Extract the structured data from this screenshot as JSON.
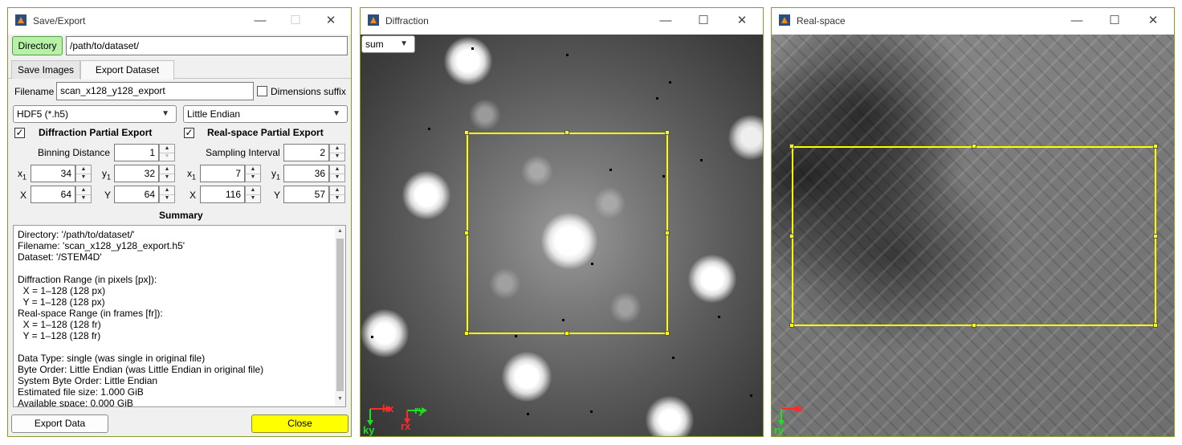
{
  "save_export": {
    "window_title": "Save/Export",
    "directory_button": "Directory",
    "directory_value": "/path/to/dataset/",
    "tabs": [
      "Save Images",
      "Export Dataset"
    ],
    "filename_label": "Filename",
    "filename_value": "scan_x128_y128_export",
    "dimensions_suffix_label": "Dimensions suffix",
    "format_value": "HDF5 (*.h5)",
    "endian_value": "Little Endian",
    "diffraction_partial_label": "Diffraction Partial Export",
    "realspace_partial_label": "Real-space Partial Export",
    "binning_label": "Binning Distance",
    "binning_value": "1",
    "sampling_label": "Sampling Interval",
    "sampling_value": "2",
    "diff_x1_label": "x",
    "diff_x1_sub": "1",
    "diff_x1": "34",
    "diff_y1_label": "y",
    "diff_y1_sub": "1",
    "diff_y1": "32",
    "diff_X_label": "X",
    "diff_X": "64",
    "diff_Y_label": "Y",
    "diff_Y": "64",
    "real_x1_label": "x",
    "real_x1_sub": "1",
    "real_x1": "7",
    "real_y1_label": "y",
    "real_y1_sub": "1",
    "real_y1": "36",
    "real_X_label": "X",
    "real_X": "116",
    "real_Y_label": "Y",
    "real_Y": "57",
    "summary_heading": "Summary",
    "summary_lines": [
      "Directory: '/path/to/dataset/'",
      "Filename: 'scan_x128_y128_export.h5'",
      "Dataset: '/STEM4D'",
      "",
      "Diffraction Range (in pixels [px]):",
      "  X = 1–128 (128 px)",
      "  Y = 1–128 (128 px)",
      "Real-space Range (in frames [fr]):",
      "  X = 1–128 (128 fr)",
      "  Y = 1–128 (128 fr)",
      "",
      "Data Type: single (was single in original file)",
      "Byte Order: Little Endian (was Little Endian in original file)",
      "System Byte Order: Little Endian",
      "Estimated file size: 1.000 GiB",
      "Available space: 0.000 GiB"
    ],
    "export_button": "Export Data",
    "close_button": "Close",
    "close_color": "#ffff00"
  },
  "diffraction": {
    "window_title": "Diffraction",
    "mode_value": "sum",
    "axis_kx": "kx",
    "axis_ky": "ky",
    "axis_rx": "rx",
    "axis_ry": "ry"
  },
  "realspace": {
    "window_title": "Real-space",
    "axis_rx": "rx",
    "axis_ry": "ry"
  },
  "colors": {
    "selection": "#ffff00",
    "directory_button": "#b6f2a6",
    "window_border": "#8a9a2a"
  }
}
